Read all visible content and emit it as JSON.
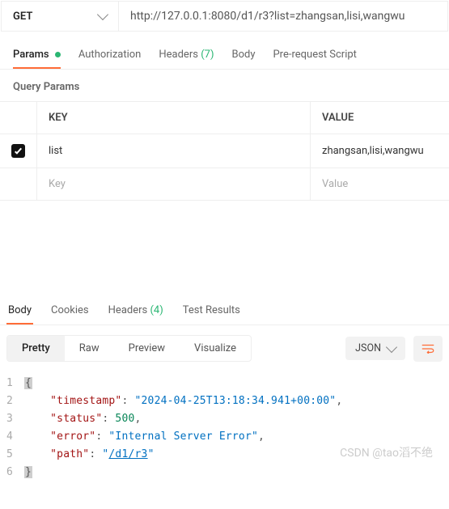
{
  "request": {
    "method": "GET",
    "url": "http://127.0.0.1:8080/d1/r3?list=zhangsan,lisi,wangwu"
  },
  "req_tabs": {
    "params": "Params",
    "authorization": "Authorization",
    "headers": "Headers",
    "headers_count": "(7)",
    "body": "Body",
    "pre_request": "Pre-request Script"
  },
  "query_params": {
    "title": "Query Params",
    "headers": {
      "key": "KEY",
      "value": "VALUE"
    },
    "rows": [
      {
        "checked": true,
        "key": "list",
        "value": "zhangsan,lisi,wangwu"
      }
    ],
    "placeholder": {
      "key": "Key",
      "value": "Value"
    }
  },
  "response_tabs": {
    "body": "Body",
    "cookies": "Cookies",
    "headers": "Headers",
    "headers_count": "(4)",
    "test_results": "Test Results"
  },
  "body_view": {
    "pretty": "Pretty",
    "raw": "Raw",
    "preview": "Preview",
    "visualize": "Visualize",
    "format": "JSON"
  },
  "response_json": {
    "timestamp_key": "\"timestamp\"",
    "timestamp_val": "\"2024-04-25T13:18:34.941+00:00\"",
    "status_key": "\"status\"",
    "status_val": "500",
    "error_key": "\"error\"",
    "error_val": "\"Internal Server Error\"",
    "path_key": "\"path\"",
    "path_val": "/d1/r3"
  },
  "line_numbers": {
    "l1": "1",
    "l2": "2",
    "l3": "3",
    "l4": "4",
    "l5": "5",
    "l6": "6"
  },
  "watermark": "CSDN @tao滔不绝"
}
